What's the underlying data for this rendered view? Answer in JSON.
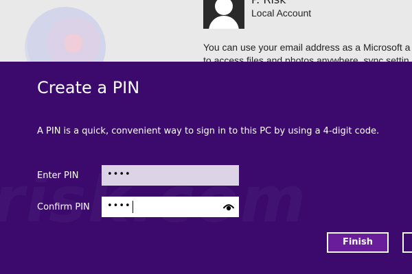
{
  "background": {
    "username": "P. Risk",
    "account_type": "Local Account",
    "description_lines": [
      "You can use your email address as a Microsoft a",
      "to access files and photos anywhere, sync settin"
    ]
  },
  "dialog": {
    "title": "Create a PIN",
    "description": "A PIN is a quick, convenient way to sign in to this PC by using a 4-digit code.",
    "enter_pin": {
      "label": "Enter PIN",
      "value": "••••"
    },
    "confirm_pin": {
      "label": "Confirm PIN",
      "value": "••••"
    },
    "finish_label": "Finish",
    "watermark": "risk.com"
  },
  "colors": {
    "dialog_background": "#3b0a6c",
    "finish_button": "#6a1d9a",
    "enter_pin_field": "#dcd3e6"
  },
  "icons": {
    "reveal": "eye-icon",
    "avatar": "user-avatar-icon"
  }
}
